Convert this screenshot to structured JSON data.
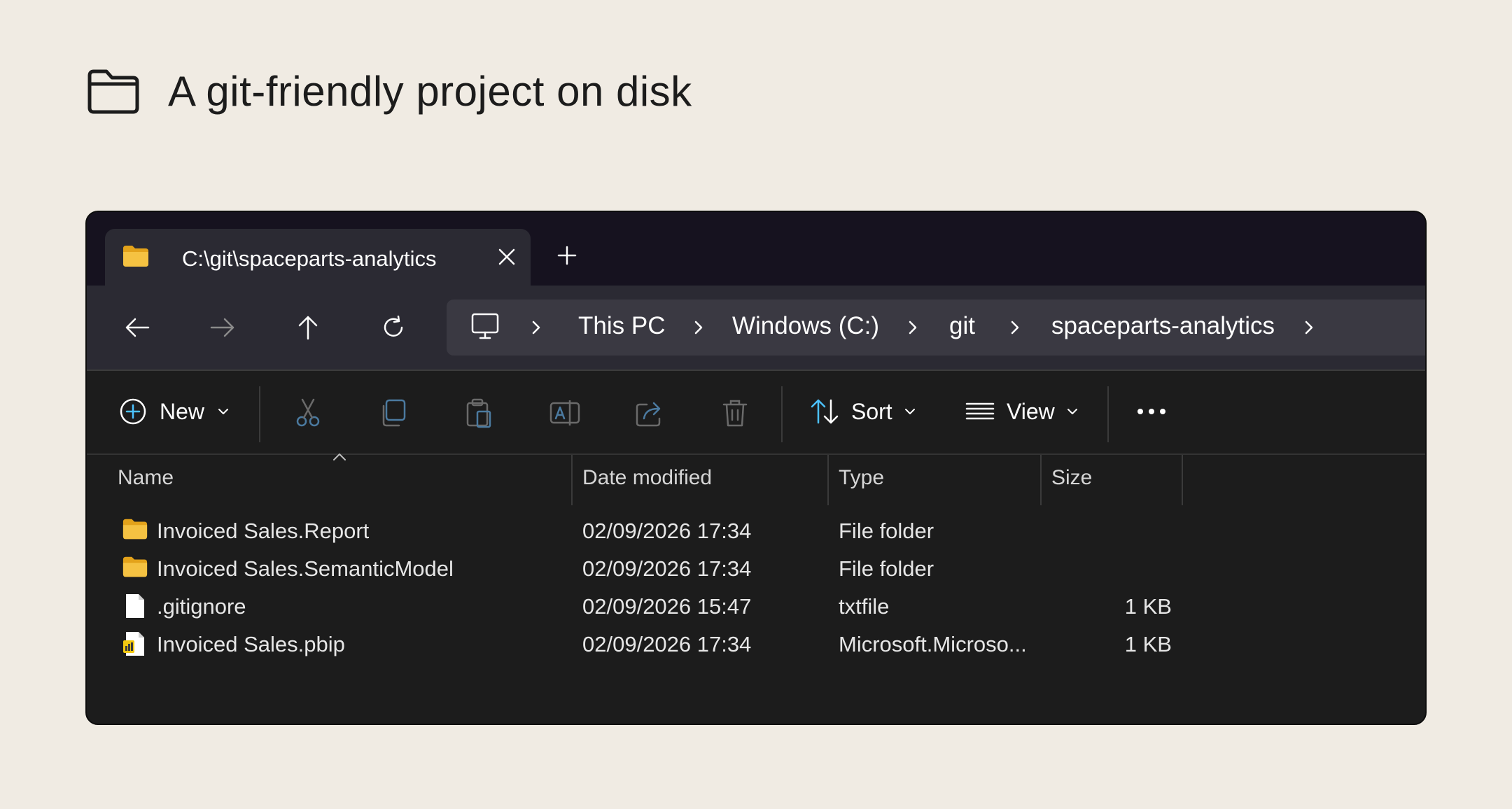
{
  "heading": {
    "text": "A git-friendly project on disk"
  },
  "tab": {
    "title": "C:\\git\\spaceparts-analytics"
  },
  "breadcrumbs": [
    "This PC",
    "Windows (C:)",
    "git",
    "spaceparts-analytics"
  ],
  "toolbar": {
    "new_label": "New",
    "sort_label": "Sort",
    "view_label": "View"
  },
  "columns": {
    "name": "Name",
    "date": "Date modified",
    "type": "Type",
    "size": "Size"
  },
  "files": [
    {
      "name": "Invoiced Sales.Report",
      "date": "02/09/2026 17:34",
      "type": "File folder",
      "size": "",
      "icon": "folder-icon"
    },
    {
      "name": "Invoiced Sales.SemanticModel",
      "date": "02/09/2026 17:34",
      "type": "File folder",
      "size": "",
      "icon": "folder-icon"
    },
    {
      "name": ".gitignore",
      "date": "02/09/2026 15:47",
      "type": "txtfile",
      "size": "1 KB",
      "icon": "text-file-icon"
    },
    {
      "name": "Invoiced Sales.pbip",
      "date": "02/09/2026 17:34",
      "type": "Microsoft.Microso...",
      "size": "1 KB",
      "icon": "pbip-file-icon"
    }
  ],
  "colors": {
    "background": "#f0ebe3",
    "window": "#1c1c1c",
    "tabstrip": "#16121f",
    "navbar": "#2b2a33",
    "folder": "#f5c242",
    "accent": "#4cc2ff"
  }
}
